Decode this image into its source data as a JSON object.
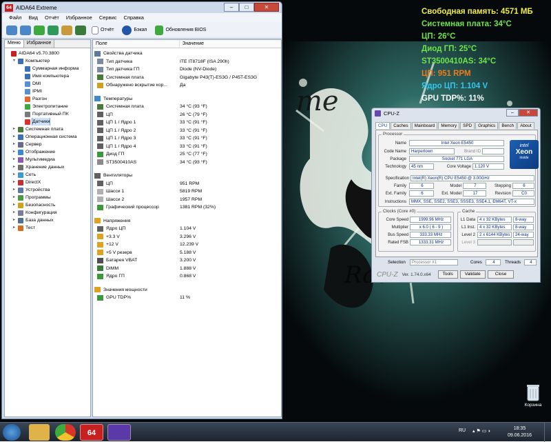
{
  "osd": [
    {
      "text": "Свободная память: 4571 МБ",
      "color": "#f2ee3a"
    },
    {
      "text": "Системная плата: 34°C",
      "color": "#6ee34a"
    },
    {
      "text": "ЦП: 26°C",
      "color": "#6ee34a"
    },
    {
      "text": "Диод ГП: 25°C",
      "color": "#6ee34a"
    },
    {
      "text": "ST3500410AS: 34°C",
      "color": "#6ee34a"
    },
    {
      "text": "ЦП: 951 RPM",
      "color": "#f07a1e"
    },
    {
      "text": "Ядро ЦП: 1.104 V",
      "color": "#34c6ee"
    },
    {
      "text": "GPU TDP%: 11%",
      "color": "#ffffff"
    }
  ],
  "aida": {
    "title": "AIDA64 Extreme",
    "icon_text": "64",
    "menu": [
      "Файл",
      "Вид",
      "Отчёт",
      "Избранное",
      "Сервис",
      "Справка"
    ],
    "toolbar": {
      "report": "Отчёт",
      "bios": "Бэкап",
      "bios_update": "Обновления BIOS"
    },
    "tabs": [
      "Меню",
      "Избранное"
    ],
    "tree": [
      {
        "label": "AIDA64 v5.70.3800",
        "level": 0,
        "color": "#c62020"
      },
      {
        "label": "Компьютер",
        "level": 1,
        "color": "#3b6fb6",
        "exp": "▾"
      },
      {
        "label": "Суммарная информа",
        "level": 2,
        "color": "#3b6fb6"
      },
      {
        "label": "Имя компьютера",
        "level": 2,
        "color": "#3b6fb6"
      },
      {
        "label": "DMI",
        "level": 2,
        "color": "#5a8fd0"
      },
      {
        "label": "IPMI",
        "level": 2,
        "color": "#5a8fd0"
      },
      {
        "label": "Разгон",
        "level": 2,
        "color": "#e06a2a"
      },
      {
        "label": "Электропитание",
        "level": 2,
        "color": "#3caa3c"
      },
      {
        "label": "Портативный ПК",
        "level": 2,
        "color": "#7a7a7a"
      },
      {
        "label": "Датчики",
        "level": 2,
        "color": "#d8342a",
        "sel": true
      },
      {
        "label": "Системная плата",
        "level": 1,
        "color": "#4a7a3a",
        "exp": "▸"
      },
      {
        "label": "Операционная система",
        "level": 1,
        "color": "#3b6fb6",
        "exp": "▸"
      },
      {
        "label": "Сервер",
        "level": 1,
        "color": "#6a6a8a",
        "exp": "▸"
      },
      {
        "label": "Отображение",
        "level": 1,
        "color": "#3b8ad0",
        "exp": "▸"
      },
      {
        "label": "Мультимедиа",
        "level": 1,
        "color": "#8a5ab0",
        "exp": "▸"
      },
      {
        "label": "Хранение данных",
        "level": 1,
        "color": "#707070",
        "exp": "▸"
      },
      {
        "label": "Сеть",
        "level": 1,
        "color": "#3b9ad0",
        "exp": "▸"
      },
      {
        "label": "DirectX",
        "level": 1,
        "color": "#c03030",
        "exp": "▸"
      },
      {
        "label": "Устройства",
        "level": 1,
        "color": "#5a7aa0",
        "exp": "▸"
      },
      {
        "label": "Программы",
        "level": 1,
        "color": "#4a9a4a",
        "exp": "▸"
      },
      {
        "label": "Безопасность",
        "level": 1,
        "color": "#d0a020",
        "exp": "▸"
      },
      {
        "label": "Конфигурация",
        "level": 1,
        "color": "#7a7a9a",
        "exp": "▸"
      },
      {
        "label": "База данных",
        "level": 1,
        "color": "#507090",
        "exp": "▸"
      },
      {
        "label": "Тест",
        "level": 1,
        "color": "#d07020",
        "exp": "▸"
      }
    ],
    "columns": {
      "field": "Поле",
      "value": "Значение"
    },
    "rows": [
      {
        "type": "sec",
        "f": "Свойства датчика",
        "v": "",
        "c": "#5a7aa0"
      },
      {
        "f": "Тип датчика",
        "v": "ITE IT8718F  (ISA 290h)",
        "c": "#7a8aa0"
      },
      {
        "f": "Тип датчика ГП",
        "v": "Diode  (NV-Diode)",
        "c": "#7a8aa0"
      },
      {
        "f": "Системная плата",
        "v": "Gigabyte P43(T)-ES3G / P45T-ES3G",
        "c": "#4a7a3a"
      },
      {
        "f": "Обнаружено вскрытие кор...",
        "v": "Да",
        "c": "#d0a020"
      },
      {
        "type": "gap"
      },
      {
        "type": "sec",
        "f": "Температуры",
        "v": "",
        "c": "#3b8ad0"
      },
      {
        "f": "Системная плата",
        "v": "34 °C  (93 °F)",
        "c": "#4a7a3a"
      },
      {
        "f": "ЦП",
        "v": "26 °C  (79 °F)",
        "c": "#606060"
      },
      {
        "f": "ЦП 1 / Ядро 1",
        "v": "33 °C  (91 °F)",
        "c": "#606060"
      },
      {
        "f": "ЦП 1 / Ядро 2",
        "v": "33 °C  (91 °F)",
        "c": "#606060"
      },
      {
        "f": "ЦП 1 / Ядро 3",
        "v": "33 °C  (91 °F)",
        "c": "#606060"
      },
      {
        "f": "ЦП 1 / Ядро 4",
        "v": "33 °C  (91 °F)",
        "c": "#606060"
      },
      {
        "f": "Диод ГП",
        "v": "25 °C  (77 °F)",
        "c": "#3a9a3a"
      },
      {
        "f": "ST3500410AS",
        "v": "34 °C  (93 °F)",
        "c": "#8a8a8a"
      },
      {
        "type": "gap"
      },
      {
        "type": "sec",
        "f": "Вентиляторы",
        "v": "",
        "c": "#606060"
      },
      {
        "f": "ЦП",
        "v": "951 RPM",
        "c": "#606060"
      },
      {
        "f": "Шасси 1",
        "v": "5819 RPM",
        "c": "#b0b0b0"
      },
      {
        "f": "Шасси 2",
        "v": "1957 RPM",
        "c": "#b0b0b0"
      },
      {
        "f": "Графический процессор",
        "v": "1381 RPM  (32%)",
        "c": "#3a9a3a"
      },
      {
        "type": "gap"
      },
      {
        "type": "sec",
        "f": "Напряжения",
        "v": "",
        "c": "#e0a020"
      },
      {
        "f": "Ядро ЦП",
        "v": "1.104 V",
        "c": "#606060"
      },
      {
        "f": "+3.3 V",
        "v": "3.296 V",
        "c": "#e0a020"
      },
      {
        "f": "+12 V",
        "v": "12.239 V",
        "c": "#e0a020"
      },
      {
        "f": "+5 V резерв",
        "v": "5.188 V",
        "c": "#e0a020"
      },
      {
        "f": "Батарея VBAT",
        "v": "3.200 V",
        "c": "#505050"
      },
      {
        "f": "DIMM",
        "v": "1.888 V",
        "c": "#3a7a3a"
      },
      {
        "f": "Ядро ГП",
        "v": "0.868 V",
        "c": "#3a9a3a"
      },
      {
        "type": "gap"
      },
      {
        "type": "sec",
        "f": "Значения мощности",
        "v": "",
        "c": "#e0a020"
      },
      {
        "f": "GPU TDP%",
        "v": "11 %",
        "c": "#3a9a3a"
      }
    ]
  },
  "cpuz": {
    "title": "CPU-Z",
    "tabs": [
      "CPU",
      "Caches",
      "Mainboard",
      "Memory",
      "SPD",
      "Graphics",
      "Bench",
      "About"
    ],
    "processor_label": "Processor",
    "fields": {
      "name": {
        "label": "Name",
        "value": "Intel Xeon E5450"
      },
      "codename": {
        "label": "Code Name",
        "value": "Harpertown",
        "brand_label": "Brand ID"
      },
      "package": {
        "label": "Package",
        "value": "Socket 771 LGA"
      },
      "technology": {
        "label": "Technology",
        "value": "45 nm",
        "voltage_label": "Core Voltage",
        "voltage": "1.120 V"
      },
      "spec": {
        "label": "Specification",
        "value": "Intel(R) Xeon(R) CPU         E5450  @ 3.00GHz"
      },
      "family": {
        "label": "Family",
        "value": "6"
      },
      "model": {
        "label": "Model",
        "value": "7"
      },
      "stepping": {
        "label": "Stepping",
        "value": "6"
      },
      "extfamily": {
        "label": "Ext. Family",
        "value": "6"
      },
      "extmodel": {
        "label": "Ext. Model",
        "value": "17"
      },
      "revision": {
        "label": "Revision",
        "value": "C0"
      },
      "instructions": {
        "label": "Instructions",
        "value": "MMX, SSE, SSE2, SSE3, SSSE3, SSE4.1, EM64T, VT-x"
      }
    },
    "clocks": {
      "label": "Clocks (Core #0)",
      "core_speed": "1999.96 MHz",
      "multiplier": "x 6.0  ( 6 - 9 )",
      "bus_speed": "333.33 MHz",
      "rated_fsb": "1333.31 MHz",
      "labels": [
        "Core Speed",
        "Multiplier",
        "Bus Speed",
        "Rated FSB"
      ]
    },
    "cache": {
      "label": "Cache",
      "l1d": "4 x 32 KBytes",
      "l1d_way": "8-way",
      "l1i": "4 x 32 KBytes",
      "l1i_way": "8-way",
      "l2": "2 x 6144 KBytes",
      "l2_way": "24-way",
      "labels": [
        "L1 Data",
        "L1 Inst.",
        "Level 2",
        "Level 3"
      ]
    },
    "selection": {
      "label": "Selection",
      "value": "Processor #1",
      "cores_label": "Cores",
      "cores": "4",
      "threads_label": "Threads",
      "threads": "4"
    },
    "footer": {
      "brand": "CPU-Z",
      "version": "Ver. 1.74.0.x64",
      "tools": "Tools",
      "validate": "Validate",
      "close": "Close"
    },
    "logo": {
      "top": "intel",
      "mid": "Xeon",
      "bot": "inside"
    }
  },
  "desktop": {
    "recycle": "Корзина"
  },
  "taskbar": {
    "lang": "RU",
    "time": "18:35",
    "date": "09.06.2016",
    "aida_icon": "64"
  }
}
